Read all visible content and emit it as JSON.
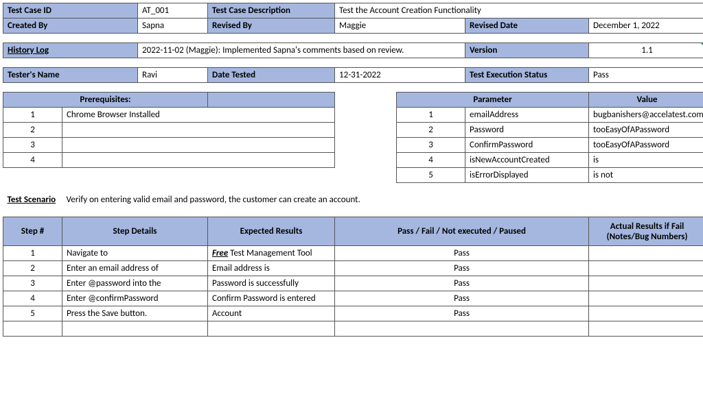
{
  "info": {
    "tcid_label": "Test Case ID",
    "tcid": "AT_001",
    "tcdesc_label": "Test Case Description",
    "tcdesc": "Test the Account Creation Functionality",
    "createdby_label": "Created By",
    "createdby": "Sapna",
    "revisedby_label": "Revised By",
    "revisedby": "Maggie",
    "reviseddate_label": "Revised Date",
    "reviseddate": "December 1, 2022",
    "history_label": "History Log",
    "history": "2022-11-02 (Maggie): Implemented Sapna's comments based on review.",
    "version_label": "Version",
    "version": "1.1",
    "tester_label": "Tester's Name",
    "tester": "Ravi",
    "datetested_label": "Date Tested",
    "datetested": "12-31-2022",
    "exec_label": "Test Execution Status",
    "exec": "Pass"
  },
  "prereq": {
    "header": "Prerequisites:",
    "rows": [
      {
        "n": "1",
        "text": "Chrome Browser Installed"
      },
      {
        "n": "2",
        "text": ""
      },
      {
        "n": "3",
        "text": ""
      },
      {
        "n": "4",
        "text": ""
      }
    ]
  },
  "params": {
    "param_header": "Parameter",
    "value_header": "Value",
    "rows": [
      {
        "n": "1",
        "p": "emailAddress",
        "v": "bugbanishers@accelatest.com"
      },
      {
        "n": "2",
        "p": "Password",
        "v": "tooEasyOfAPassword"
      },
      {
        "n": "3",
        "p": "ConfirmPassword",
        "v": "tooEasyOfAPassword"
      },
      {
        "n": "4",
        "p": "isNewAccountCreated",
        "v": "is"
      },
      {
        "n": "5",
        "p": "isErrorDisplayed",
        "v": "is not"
      }
    ]
  },
  "scenario": {
    "label": "Test Scenario",
    "text": "Verify on entering valid email and password, the customer can create an account."
  },
  "steps": {
    "headers": {
      "step": "Step #",
      "details": "Step Details",
      "expected": "Expected Results",
      "passfail": "Pass / Fail / Not executed / Paused",
      "actual": "Actual Results if Fail (Notes/Bug Numbers)"
    },
    "free_label": "Free",
    "tool_suffix": "  Test Management Tool",
    "rows": [
      {
        "n": "1",
        "details": "Navigate to",
        "pf": "Pass",
        "actual": ""
      },
      {
        "n": "2",
        "details": "Enter an email address of",
        "expected": "Email address is",
        "pf": "Pass",
        "actual": ""
      },
      {
        "n": "3",
        "details": "Enter @password into the",
        "expected": "Password is successfully",
        "pf": "Pass",
        "actual": ""
      },
      {
        "n": "4",
        "details": "Enter @confirmPassword",
        "expected": "Confirm Password is entered",
        "pf": "Pass",
        "actual": ""
      },
      {
        "n": "5",
        "details": "Press the Save button.",
        "expected": "Account",
        "pf": "Pass",
        "actual": ""
      }
    ]
  }
}
